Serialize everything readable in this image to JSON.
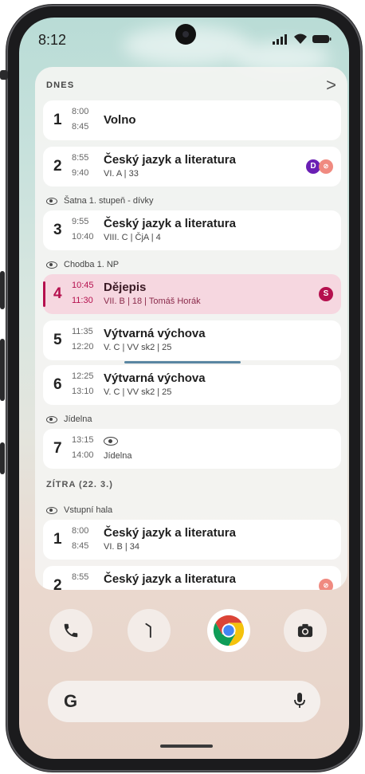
{
  "status": {
    "time": "8:12"
  },
  "today": {
    "header": "DNES",
    "chevron": ">",
    "lessons": [
      {
        "num": "1",
        "start": "8:00",
        "end": "8:45",
        "subject": "Volno",
        "detail": ""
      },
      {
        "num": "2",
        "start": "8:55",
        "end": "9:40",
        "subject": "Český jazyk a literatura",
        "detail": "VI. A | 33",
        "badge": "D"
      },
      {
        "num": "3",
        "start": "9:55",
        "end": "10:40",
        "subject": "Český jazyk a literatura",
        "detail": "VIII. C | ČjA | 4"
      },
      {
        "num": "4",
        "start": "10:45",
        "end": "11:30",
        "subject": "Dějepis",
        "detail": "VII. B | 18 | Tomáš Horák",
        "badge": "S"
      },
      {
        "num": "5",
        "start": "11:35",
        "end": "12:20",
        "subject": "Výtvarná výchova",
        "detail": "V. C | VV sk2 | 25"
      },
      {
        "num": "6",
        "start": "12:25",
        "end": "13:10",
        "subject": "Výtvarná výchova",
        "detail": "V. C | VV sk2 | 25"
      },
      {
        "num": "7",
        "start": "13:15",
        "end": "14:00",
        "subject": "",
        "detail": "Jídelna"
      }
    ],
    "breaks": [
      "Šatna 1. stupeň - dívky",
      "Chodba 1. NP",
      "Jídelna"
    ]
  },
  "tomorrow": {
    "header": "ZÍTRA (22. 3.)",
    "break": "Vstupní hala",
    "lessons": [
      {
        "num": "1",
        "start": "8:00",
        "end": "8:45",
        "subject": "Český jazyk a literatura",
        "detail": "VI. B | 34"
      },
      {
        "num": "2",
        "start": "8:55",
        "end": "",
        "subject": "Český jazyk a literatura",
        "detail": ""
      }
    ]
  },
  "search": {
    "logo": "G"
  },
  "colors": {
    "accent": "#b5104e",
    "current_bg": "#f6d7e0",
    "badge_d": "#6a1fb4",
    "now_line": "#5a86a2"
  },
  "icons": [
    "phone-icon",
    "messages-icon",
    "chrome-icon",
    "camera-icon",
    "microphone-icon",
    "eye-icon",
    "wifi-icon",
    "signal-icon",
    "battery-icon"
  ]
}
